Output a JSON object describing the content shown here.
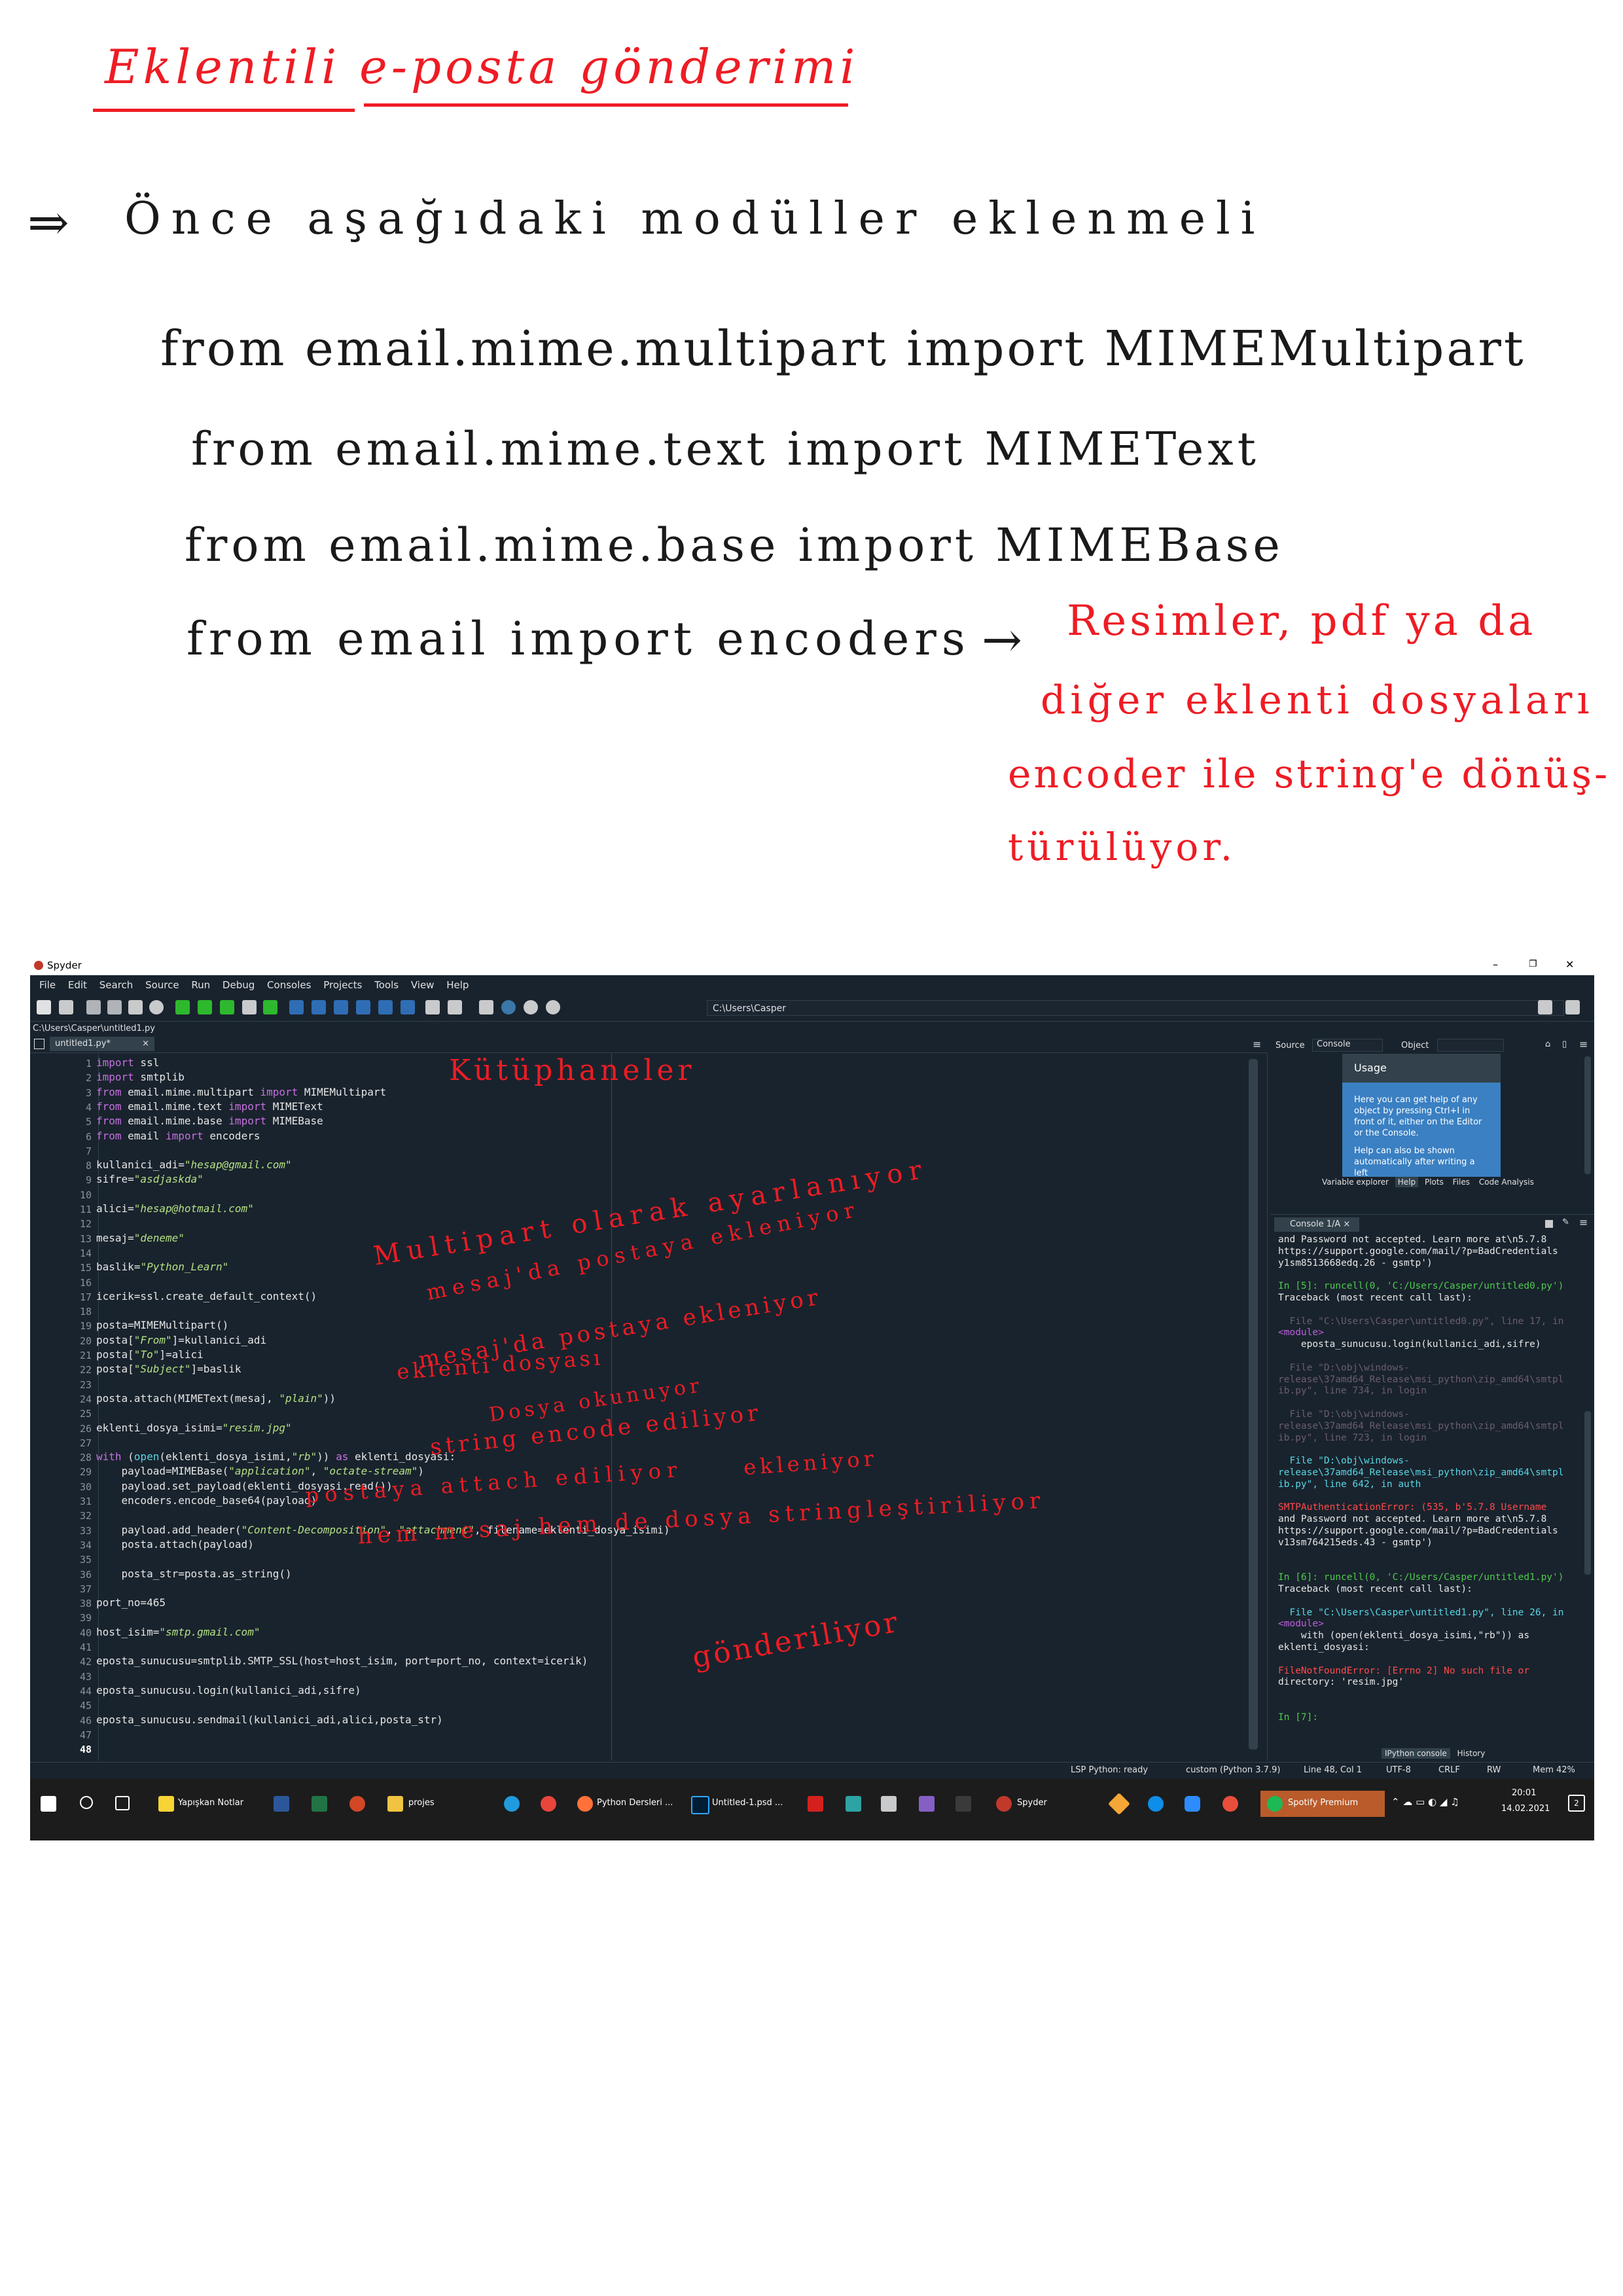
{
  "notes": {
    "title": "Eklentili e-posta gönderimi",
    "intro_arrow": "⇒",
    "intro": "Önce aşağıdaki modüller eklenmeli",
    "imports": [
      "from email.mime.multipart import MIMEMultipart",
      "from email.mime.text import MIMEText",
      "from email.mime.base import MIMEBase",
      "from email import encoders"
    ],
    "arrow": "→",
    "side_note": [
      "Resimler, pdf ya da",
      "diğer eklenti dosyaları",
      "encoder ile string'e dönüş-",
      "türülüyor."
    ]
  },
  "window": {
    "app_title": "Spyder",
    "minimize": "–",
    "restore": "❐",
    "close": "✕",
    "menu": [
      "File",
      "Edit",
      "Search",
      "Source",
      "Run",
      "Debug",
      "Consoles",
      "Projects",
      "Tools",
      "View",
      "Help"
    ],
    "working_dir": "C:\\Users\\Casper",
    "file_path": "C:\\Users\\Casper\\untitled1.py",
    "tab_label": "untitled1.py*"
  },
  "editor": {
    "lines": [
      "import ssl",
      "import smtplib",
      "from email.mime.multipart import MIMEMultipart",
      "from email.mime.text import MIMEText",
      "from email.mime.base import MIMEBase",
      "from email import encoders",
      "",
      "kullanici_adi=\"hesap@gmail.com\"",
      "sifre=\"asdjaskda\"",
      "",
      "alici=\"hesap@hotmail.com\"",
      "",
      "mesaj=\"deneme\"",
      "",
      "baslik=\"Python_Learn\"",
      "",
      "icerik=ssl.create_default_context()",
      "",
      "posta=MIMEMultipart()",
      "posta[\"From\"]=kullanici_adi",
      "posta[\"To\"]=alici",
      "posta[\"Subject\"]=baslik",
      "",
      "posta.attach(MIMEText(mesaj, \"plain\"))",
      "",
      "eklenti_dosya_isimi=\"resim.jpg\"",
      "",
      "with (open(eklenti_dosya_isimi,\"rb\")) as eklenti_dosyasi:",
      "    payload=MIMEBase(\"application\", \"octate-stream\")",
      "    payload.set_payload(eklenti_dosyasi.read())",
      "    encoders.encode_base64(payload)",
      "",
      "    payload.add_header(\"Content-Decomposition\", \"attachment\", filename=eklenti_dosya_isimi)",
      "    posta.attach(payload)",
      "",
      "    posta_str=posta.as_string()",
      "",
      "port_no=465",
      "",
      "host_isim=\"smtp.gmail.com\"",
      "",
      "eposta_sunucusu=smtplib.SMTP_SSL(host=host_isim, port=port_no, context=icerik)",
      "",
      "eposta_sunucusu.login(kullanici_adi,sifre)",
      "",
      "eposta_sunucusu.sendmail(kullanici_adi,alici,posta_str)",
      "",
      ""
    ],
    "annotations": [
      "Kütüphaneler",
      "Multipart olarak ayarlanıyor",
      "mesaj'da postaya ekleniyor",
      "mesaj'da postaya ekleniyor",
      "eklenti dosyası",
      "Dosya okunuyor",
      "string encode ediliyor",
      "ekleniyor",
      "postaya attach ediliyor",
      "hem mesaj hem de dosya stringleştiriliyor",
      "gönderiliyor"
    ]
  },
  "help": {
    "source_label": "Source",
    "source_value": "Console",
    "object_label": "Object",
    "usage_title": "Usage",
    "usage_text": [
      "Here you can get help of any",
      "object by pressing Ctrl+I in",
      "front of it, either on the Editor",
      "or the Console.",
      "",
      "Help can also be shown",
      "automatically after writing a left"
    ],
    "tabs": [
      "Variable explorer",
      "Help",
      "Plots",
      "Files",
      "Code Analysis"
    ]
  },
  "console": {
    "tab_label": "Console 1/A",
    "lines": [
      {
        "t": "and Password not accepted. Learn more at\\n5.7.8",
        "c": ""
      },
      {
        "t": "https://support.google.com/mail/?p=BadCredentials",
        "c": ""
      },
      {
        "t": "y1sm8513668edq.26 - gsmtp')",
        "c": ""
      },
      {
        "t": "",
        "c": ""
      },
      {
        "t": "In [5]: runcell(0, 'C:/Users/Casper/untitled0.py')",
        "c": "cg"
      },
      {
        "t": "Traceback (most recent call last):",
        "c": ""
      },
      {
        "t": "",
        "c": ""
      },
      {
        "t": "  File \"C:\\Users\\Casper\\untitled0.py\", line 17, in",
        "c": "cdim"
      },
      {
        "t": "<module>",
        "c": "cm"
      },
      {
        "t": "    eposta_sunucusu.login(kullanici_adi,sifre)",
        "c": ""
      },
      {
        "t": "",
        "c": ""
      },
      {
        "t": "  File \"D:\\obj\\windows-",
        "c": "cdim"
      },
      {
        "t": "release\\37amd64_Release\\msi_python\\zip_amd64\\smtpl",
        "c": "cdim"
      },
      {
        "t": "ib.py\", line 734, in login",
        "c": "cdim"
      },
      {
        "t": "",
        "c": ""
      },
      {
        "t": "  File \"D:\\obj\\windows-",
        "c": "cdim"
      },
      {
        "t": "release\\37amd64_Release\\msi_python\\zip_amd64\\smtpl",
        "c": "cdim"
      },
      {
        "t": "ib.py\", line 723, in login",
        "c": "cdim"
      },
      {
        "t": "",
        "c": ""
      },
      {
        "t": "  File \"D:\\obj\\windows-",
        "c": "cc"
      },
      {
        "t": "release\\37amd64_Release\\msi_python\\zip_amd64\\smtpl",
        "c": "cc"
      },
      {
        "t": "ib.py\", line 642, in auth",
        "c": "cc"
      },
      {
        "t": "",
        "c": ""
      },
      {
        "t": "SMTPAuthenticationError: (535, b'5.7.8 Username",
        "c": "cr"
      },
      {
        "t": "and Password not accepted. Learn more at\\n5.7.8",
        "c": ""
      },
      {
        "t": "https://support.google.com/mail/?p=BadCredentials",
        "c": ""
      },
      {
        "t": "v13sm764215eds.43 - gsmtp')",
        "c": ""
      },
      {
        "t": "",
        "c": ""
      },
      {
        "t": "",
        "c": ""
      },
      {
        "t": "In [6]: runcell(0, 'C:/Users/Casper/untitled1.py')",
        "c": "cg"
      },
      {
        "t": "Traceback (most recent call last):",
        "c": ""
      },
      {
        "t": "",
        "c": ""
      },
      {
        "t": "  File \"C:\\Users\\Casper\\untitled1.py\", line 26, in",
        "c": "cc"
      },
      {
        "t": "<module>",
        "c": "cm"
      },
      {
        "t": "    with (open(eklenti_dosya_isimi,\"rb\")) as",
        "c": ""
      },
      {
        "t": "eklenti_dosyasi:",
        "c": ""
      },
      {
        "t": "",
        "c": ""
      },
      {
        "t": "FileNotFoundError: [Errno 2] No such file or",
        "c": "cr"
      },
      {
        "t": "directory: 'resim.jpg'",
        "c": ""
      },
      {
        "t": "",
        "c": ""
      },
      {
        "t": "",
        "c": ""
      },
      {
        "t": "In [7]:",
        "c": "cg"
      }
    ],
    "tabs": [
      "IPython console",
      "History"
    ]
  },
  "status": {
    "lsp": "LSP Python: ready",
    "env": "custom (Python 3.7.9)",
    "pos": "Line 48, Col 1",
    "enc": "UTF-8",
    "eol": "CRLF",
    "rw": "RW",
    "mem": "Mem 42%"
  },
  "taskbar": {
    "apps": [
      "Yapışkan Notlar",
      "projes",
      "Python Dersleri ...",
      "Untitled-1.psd ...",
      "Spyder",
      "Spotify Premium"
    ],
    "time": "20:01",
    "date": "14.02.2021",
    "notif": "2"
  },
  "colors": {
    "ink_red": "#ee1c24",
    "ink_black": "#1a1a1a",
    "ide_bg": "#19232d"
  }
}
